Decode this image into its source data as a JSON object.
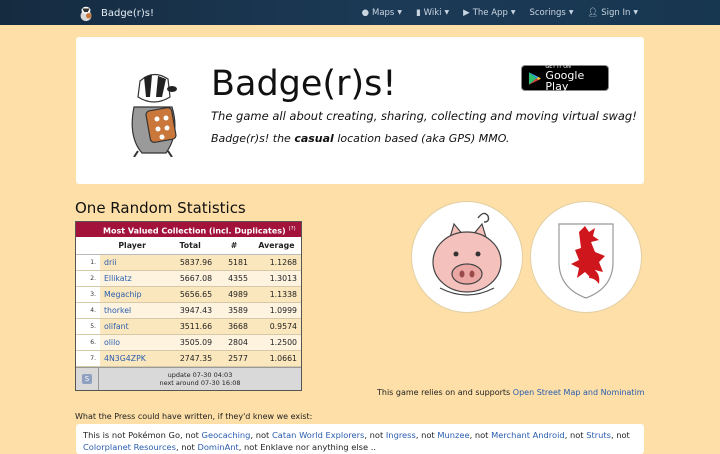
{
  "navbar": {
    "brand": "Badge(r)s!",
    "items": [
      {
        "icon": "globe-icon",
        "label": "Maps"
      },
      {
        "icon": "book-icon",
        "label": "Wiki"
      },
      {
        "icon": "play-icon",
        "label": "The App"
      },
      {
        "icon": "none",
        "label": "Scorings"
      },
      {
        "icon": "user-icon",
        "label": "Sign In"
      }
    ]
  },
  "hero": {
    "title": "Badge(r)s!",
    "subtitle": "The game all about creating, sharing, collecting and moving virtual swag!",
    "tagline_pre": "Badge(r)s! the ",
    "tagline_bold": "casual",
    "tagline_post": " location based (aka GPS) MMO.",
    "store_small": "GET IT ON",
    "store_big": "Google Play"
  },
  "stats": {
    "section_title": "One Random Statistics",
    "table_title": "Most Valued Collection (incl. Duplicates)",
    "help_mark": "(?)",
    "columns": [
      "Player",
      "Total",
      "#",
      "Average"
    ],
    "rows": [
      {
        "idx": "1.",
        "player": "drii",
        "total": "5837.96",
        "count": "5181",
        "avg": "1.1268"
      },
      {
        "idx": "2.",
        "player": "Ellikatz",
        "total": "5667.08",
        "count": "4355",
        "avg": "1.3013"
      },
      {
        "idx": "3.",
        "player": "Megachip",
        "total": "5656.65",
        "count": "4989",
        "avg": "1.1338"
      },
      {
        "idx": "4.",
        "player": "thorkel",
        "total": "3947.43",
        "count": "3589",
        "avg": "1.0999"
      },
      {
        "idx": "5.",
        "player": "olifant",
        "total": "3511.66",
        "count": "3668",
        "avg": "0.9574"
      },
      {
        "idx": "6.",
        "player": "olilo",
        "total": "3505.09",
        "count": "2804",
        "avg": "1.2500"
      },
      {
        "idx": "7.",
        "player": "4N3G4ZPK",
        "total": "2747.35",
        "count": "2577",
        "avg": "1.0661"
      }
    ],
    "footer_button": "S",
    "update_line": "update 07-30 04:03",
    "next_line": "next around 07-30 16:08"
  },
  "osm": {
    "text": "This game relies on and supports ",
    "link": "Open Street Map and Nominatim"
  },
  "press": {
    "label": "What the Press could have written, if they'd knew we exist:",
    "parts": [
      {
        "t": "This is not Pokémon Go, not "
      },
      {
        "link": "Geocaching"
      },
      {
        "t": ", not "
      },
      {
        "link": "Catan World Explorers"
      },
      {
        "t": ", not "
      },
      {
        "link": "Ingress"
      },
      {
        "t": ", not "
      },
      {
        "link": "Munzee"
      },
      {
        "t": ", not "
      },
      {
        "link": "Merchant Android"
      },
      {
        "t": ", not "
      },
      {
        "link": "Struts"
      },
      {
        "t": ", not "
      },
      {
        "link": "Colorplanet Resources"
      },
      {
        "t": ", not "
      },
      {
        "link": "DominAnt"
      },
      {
        "t": ", not Enklave nor anything else .."
      }
    ]
  },
  "colors": {
    "navbar": "#152b40",
    "background": "#fddfa7",
    "table_header": "#a3123b",
    "link": "#2a5db0",
    "coat_of_arms_lion": "#d0161d"
  }
}
